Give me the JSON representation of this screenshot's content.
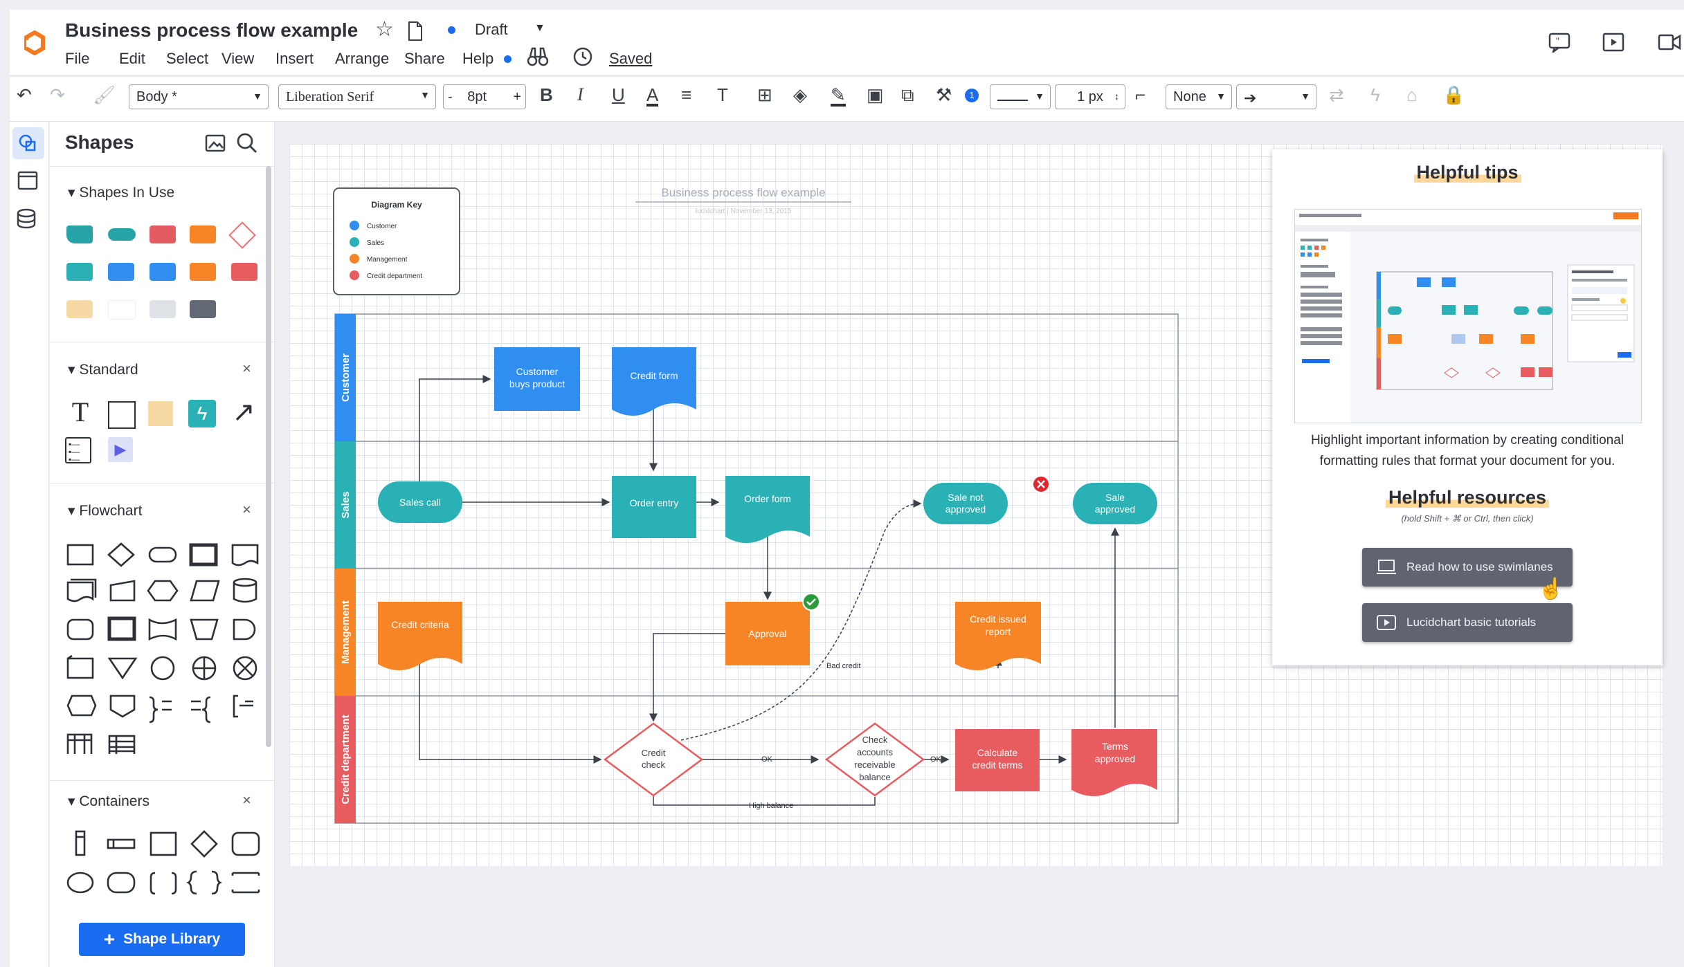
{
  "header": {
    "title": "Business process flow example",
    "status": "Draft",
    "saved": "Saved",
    "menu": [
      "File",
      "Edit",
      "Select",
      "View",
      "Insert",
      "Arrange",
      "Share",
      "Help"
    ]
  },
  "toolbar": {
    "style_select": "Body *",
    "font_select": "Liberation Serif",
    "font_size": "8pt",
    "minus": "-",
    "plus": "+",
    "bold": "B",
    "italic": "I",
    "underline": "U",
    "font_color": "A",
    "text_options": "T",
    "badge": "1",
    "line_width": "1 px",
    "endpoint": "None"
  },
  "panel": {
    "title": "Shapes",
    "sections": {
      "in_use": "Shapes In Use",
      "standard": "Standard",
      "flowchart": "Flowchart",
      "containers": "Containers"
    },
    "swatches": [
      "#27a3a8",
      "#27a3a8",
      "#e45c62",
      "#f78526",
      "#ef6f73",
      "#2ab1b5",
      "#2f8ef0",
      "#2f8ef0",
      "#f78526",
      "#e85b5e",
      "#f7d9a4",
      "#ffffff",
      "#dfe3e8",
      "#626874"
    ],
    "shape_library": "Shape Library"
  },
  "diagram": {
    "title": "Business process flow example",
    "subtitle": "lucidchart  |  November 13, 2015",
    "key": {
      "title": "Diagram Key",
      "items": [
        {
          "label": "Customer",
          "color": "#2f8ef0"
        },
        {
          "label": "Sales",
          "color": "#2ab1b5"
        },
        {
          "label": "Management",
          "color": "#f78526"
        },
        {
          "label": "Credit department",
          "color": "#e85b5e"
        }
      ]
    },
    "lanes": [
      {
        "label": "Customer",
        "color": "#2f8ef0"
      },
      {
        "label": "Sales",
        "color": "#2ab1b5"
      },
      {
        "label": "Management",
        "color": "#f78526"
      },
      {
        "label": "Credit department",
        "color": "#e85b5e"
      }
    ],
    "nodes": {
      "customer_buys_l1": "Customer",
      "customer_buys_l2": "buys product",
      "credit_form": "Credit form",
      "sales_call": "Sales call",
      "order_entry": "Order entry",
      "order_form": "Order form",
      "sale_not_approved_l1": "Sale not",
      "sale_not_approved_l2": "approved",
      "sale_approved_l1": "Sale",
      "sale_approved_l2": "approved",
      "credit_criteria": "Credit criteria",
      "approval": "Approval",
      "credit_issued_l1": "Credit issued",
      "credit_issued_l2": "report",
      "credit_check_l1": "Credit",
      "credit_check_l2": "check",
      "check_accounts_l1": "Check",
      "check_accounts_l2": "accounts",
      "check_accounts_l3": "receivable",
      "check_accounts_l4": "balance",
      "calculate_terms_l1": "Calculate",
      "calculate_terms_l2": "credit terms",
      "terms_approved_l1": "Terms",
      "terms_approved_l2": "approved"
    },
    "edges": {
      "bad_credit": "Bad credit",
      "ok1": "OK",
      "ok2": "OK",
      "high_balance": "High balance"
    }
  },
  "tips": {
    "title": "Helpful tips",
    "text": "Highlight important information by creating conditional formatting rules that format your document for you.",
    "resources_title": "Helpful resources",
    "resources_sub": "(hold Shift + ⌘ or Ctrl, then click)",
    "btn1": "Read how to use swimlanes",
    "btn2": "Lucidchart basic tutorials"
  },
  "colors": {
    "accent": "#1a6cf0",
    "customer": "#2f8ef0",
    "sales": "#2ab1b5",
    "management": "#f78526",
    "credit": "#e85b5e"
  },
  "icons": {
    "logo": "lucid-logo-icon",
    "star": "star-icon",
    "doc": "document-icon",
    "history": "clock-icon"
  }
}
